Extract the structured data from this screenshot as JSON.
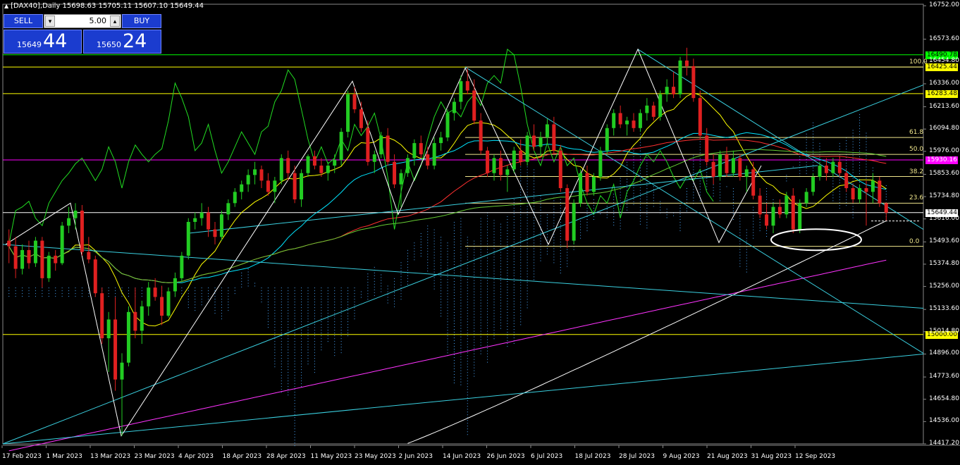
{
  "header": {
    "symbol_line": "[DAX40],Daily  15698.63 15705.11 15607.10 15649.44"
  },
  "trade_panel": {
    "sell_label": "SELL",
    "buy_label": "BUY",
    "lot": "5.00",
    "sell_price_small": "15649",
    "sell_price_big": "44",
    "buy_price_small": "15650",
    "buy_price_big": "24"
  },
  "chart_data": {
    "type": "candlestick",
    "symbol": "[DAX40]",
    "timeframe": "Daily",
    "ohlc_last": {
      "open": 15698.63,
      "high": 15705.11,
      "low": 15607.1,
      "close": 15649.44
    },
    "ylim": [
      14417.2,
      16760
    ],
    "y_ticks": [
      "16752.00",
      "16573.60",
      "16454.80",
      "16336.00",
      "16213.60",
      "16094.80",
      "15976.00",
      "15853.60",
      "15734.80",
      "15616.00",
      "15493.60",
      "15374.80",
      "15256.00",
      "15133.60",
      "15014.80",
      "14896.00",
      "14773.60",
      "14654.80",
      "14536.00",
      "14417.20"
    ],
    "x_ticks": [
      "17 Feb 2023",
      "1 Mar 2023",
      "13 Mar 2023",
      "23 Mar 2023",
      "4 Apr 2023",
      "18 Apr 2023",
      "28 Apr 2023",
      "11 May 2023",
      "23 May 2023",
      "2 Jun 2023",
      "14 Jun 2023",
      "26 Jun 2023",
      "6 Jul 2023",
      "18 Jul 2023",
      "28 Jul 2023",
      "9 Aug 2023",
      "21 Aug 2023",
      "31 Aug 2023",
      "12 Sep 2023"
    ],
    "horizontal_levels": [
      {
        "label": "16490.78",
        "value": 16490.78,
        "color": "#00ff00"
      },
      {
        "label": "16425.44",
        "value": 16425.44,
        "color": "#ffff00"
      },
      {
        "label": "16283.48",
        "value": 16283.48,
        "color": "#ffff00"
      },
      {
        "label": "15930.16",
        "value": 15930.16,
        "color": "#ff00ff"
      },
      {
        "label": "15649.44",
        "value": 15649.44,
        "color": "#ffffff"
      },
      {
        "label": "15000.00",
        "value": 15000.0,
        "color": "#ffff00"
      }
    ],
    "fibonacci": [
      {
        "label": "100.0",
        "value": 16425.44
      },
      {
        "label": "61.8",
        "value": 16050
      },
      {
        "label": "50.0",
        "value": 15960
      },
      {
        "label": "38.2",
        "value": 15842
      },
      {
        "label": "23.6",
        "value": 15700
      },
      {
        "label": "0.0",
        "value": 15470
      }
    ],
    "candles": [
      {
        "o": 15500,
        "h": 15560,
        "l": 15380,
        "c": 15470
      },
      {
        "o": 15470,
        "h": 15520,
        "l": 15300,
        "c": 15350
      },
      {
        "o": 15350,
        "h": 15480,
        "l": 15320,
        "c": 15450
      },
      {
        "o": 15450,
        "h": 15500,
        "l": 15350,
        "c": 15380
      },
      {
        "o": 15380,
        "h": 15520,
        "l": 15360,
        "c": 15500
      },
      {
        "o": 15500,
        "h": 15520,
        "l": 15250,
        "c": 15300
      },
      {
        "o": 15300,
        "h": 15440,
        "l": 15280,
        "c": 15420
      },
      {
        "o": 15420,
        "h": 15450,
        "l": 15340,
        "c": 15380
      },
      {
        "o": 15380,
        "h": 15600,
        "l": 15370,
        "c": 15580
      },
      {
        "o": 15580,
        "h": 15680,
        "l": 15540,
        "c": 15620
      },
      {
        "o": 15620,
        "h": 15700,
        "l": 15560,
        "c": 15660
      },
      {
        "o": 15660,
        "h": 15690,
        "l": 15420,
        "c": 15440
      },
      {
        "o": 15440,
        "h": 15520,
        "l": 15380,
        "c": 15400
      },
      {
        "o": 15400,
        "h": 15420,
        "l": 15200,
        "c": 15220
      },
      {
        "o": 15220,
        "h": 15250,
        "l": 14950,
        "c": 14980
      },
      {
        "o": 14980,
        "h": 15120,
        "l": 14800,
        "c": 15080
      },
      {
        "o": 15080,
        "h": 15200,
        "l": 14700,
        "c": 14760
      },
      {
        "o": 14760,
        "h": 14900,
        "l": 14460,
        "c": 14850
      },
      {
        "o": 14850,
        "h": 15150,
        "l": 14830,
        "c": 15120
      },
      {
        "o": 15120,
        "h": 15250,
        "l": 14980,
        "c": 15020
      },
      {
        "o": 15020,
        "h": 15180,
        "l": 14950,
        "c": 15150
      },
      {
        "o": 15150,
        "h": 15280,
        "l": 15100,
        "c": 15250
      },
      {
        "o": 15250,
        "h": 15300,
        "l": 15180,
        "c": 15200
      },
      {
        "o": 15200,
        "h": 15260,
        "l": 15050,
        "c": 15100
      },
      {
        "o": 15100,
        "h": 15250,
        "l": 15090,
        "c": 15230
      },
      {
        "o": 15230,
        "h": 15330,
        "l": 15200,
        "c": 15300
      },
      {
        "o": 15300,
        "h": 15440,
        "l": 15280,
        "c": 15420
      },
      {
        "o": 15420,
        "h": 15620,
        "l": 15400,
        "c": 15600
      },
      {
        "o": 15600,
        "h": 15650,
        "l": 15560,
        "c": 15620
      },
      {
        "o": 15620,
        "h": 15700,
        "l": 15580,
        "c": 15650
      },
      {
        "o": 15650,
        "h": 15680,
        "l": 15520,
        "c": 15560
      },
      {
        "o": 15560,
        "h": 15600,
        "l": 15480,
        "c": 15520
      },
      {
        "o": 15520,
        "h": 15660,
        "l": 15500,
        "c": 15640
      },
      {
        "o": 15640,
        "h": 15720,
        "l": 15610,
        "c": 15700
      },
      {
        "o": 15700,
        "h": 15780,
        "l": 15680,
        "c": 15760
      },
      {
        "o": 15760,
        "h": 15820,
        "l": 15720,
        "c": 15800
      },
      {
        "o": 15800,
        "h": 15880,
        "l": 15760,
        "c": 15850
      },
      {
        "o": 15850,
        "h": 15920,
        "l": 15800,
        "c": 15880
      },
      {
        "o": 15880,
        "h": 15900,
        "l": 15780,
        "c": 15820
      },
      {
        "o": 15820,
        "h": 15860,
        "l": 15740,
        "c": 15760
      },
      {
        "o": 15760,
        "h": 15840,
        "l": 15700,
        "c": 15820
      },
      {
        "o": 15820,
        "h": 15960,
        "l": 15800,
        "c": 15940
      },
      {
        "o": 15940,
        "h": 15980,
        "l": 15820,
        "c": 15860
      },
      {
        "o": 15860,
        "h": 15900,
        "l": 15700,
        "c": 15720
      },
      {
        "o": 15720,
        "h": 15880,
        "l": 15680,
        "c": 15860
      },
      {
        "o": 15860,
        "h": 15960,
        "l": 15840,
        "c": 15950
      },
      {
        "o": 15950,
        "h": 15980,
        "l": 15880,
        "c": 15900
      },
      {
        "o": 15900,
        "h": 15940,
        "l": 15840,
        "c": 15860
      },
      {
        "o": 15860,
        "h": 15920,
        "l": 15820,
        "c": 15900
      },
      {
        "o": 15900,
        "h": 15960,
        "l": 15860,
        "c": 15930
      },
      {
        "o": 15930,
        "h": 16100,
        "l": 15900,
        "c": 16080
      },
      {
        "o": 16080,
        "h": 16300,
        "l": 16050,
        "c": 16280
      },
      {
        "o": 16280,
        "h": 16320,
        "l": 16180,
        "c": 16200
      },
      {
        "o": 16200,
        "h": 16240,
        "l": 16080,
        "c": 16100
      },
      {
        "o": 16100,
        "h": 16140,
        "l": 15900,
        "c": 15920
      },
      {
        "o": 15920,
        "h": 15980,
        "l": 15860,
        "c": 15960
      },
      {
        "o": 15960,
        "h": 16080,
        "l": 15940,
        "c": 16060
      },
      {
        "o": 16060,
        "h": 16100,
        "l": 15900,
        "c": 15920
      },
      {
        "o": 15920,
        "h": 15960,
        "l": 15780,
        "c": 15800
      },
      {
        "o": 15800,
        "h": 15880,
        "l": 15680,
        "c": 15860
      },
      {
        "o": 15860,
        "h": 15960,
        "l": 15840,
        "c": 15940
      },
      {
        "o": 15940,
        "h": 16040,
        "l": 15900,
        "c": 16020
      },
      {
        "o": 16020,
        "h": 16060,
        "l": 15940,
        "c": 15960
      },
      {
        "o": 15960,
        "h": 16000,
        "l": 15880,
        "c": 15900
      },
      {
        "o": 15900,
        "h": 16050,
        "l": 15880,
        "c": 16020
      },
      {
        "o": 16020,
        "h": 16080,
        "l": 15980,
        "c": 16050
      },
      {
        "o": 16050,
        "h": 16200,
        "l": 16030,
        "c": 16180
      },
      {
        "o": 16180,
        "h": 16260,
        "l": 16140,
        "c": 16240
      },
      {
        "o": 16240,
        "h": 16380,
        "l": 16200,
        "c": 16350
      },
      {
        "o": 16350,
        "h": 16420,
        "l": 16280,
        "c": 16300
      },
      {
        "o": 16300,
        "h": 16360,
        "l": 16120,
        "c": 16140
      },
      {
        "o": 16140,
        "h": 16180,
        "l": 15960,
        "c": 15980
      },
      {
        "o": 15980,
        "h": 16000,
        "l": 15840,
        "c": 15860
      },
      {
        "o": 15860,
        "h": 15960,
        "l": 15820,
        "c": 15940
      },
      {
        "o": 15940,
        "h": 15980,
        "l": 15820,
        "c": 15850
      },
      {
        "o": 15850,
        "h": 15900,
        "l": 15760,
        "c": 15880
      },
      {
        "o": 15880,
        "h": 16000,
        "l": 15860,
        "c": 15980
      },
      {
        "o": 15980,
        "h": 16040,
        "l": 15900,
        "c": 15920
      },
      {
        "o": 15920,
        "h": 16080,
        "l": 15900,
        "c": 16060
      },
      {
        "o": 16060,
        "h": 16120,
        "l": 15980,
        "c": 16000
      },
      {
        "o": 16000,
        "h": 16080,
        "l": 15950,
        "c": 16050
      },
      {
        "o": 16050,
        "h": 16150,
        "l": 16020,
        "c": 16120
      },
      {
        "o": 16120,
        "h": 16160,
        "l": 15960,
        "c": 15980
      },
      {
        "o": 15980,
        "h": 16010,
        "l": 15760,
        "c": 15780
      },
      {
        "o": 15780,
        "h": 15800,
        "l": 15460,
        "c": 15500
      },
      {
        "o": 15500,
        "h": 15720,
        "l": 15480,
        "c": 15700
      },
      {
        "o": 15700,
        "h": 15880,
        "l": 15680,
        "c": 15860
      },
      {
        "o": 15860,
        "h": 15900,
        "l": 15740,
        "c": 15760
      },
      {
        "o": 15760,
        "h": 15860,
        "l": 15740,
        "c": 15840
      },
      {
        "o": 15840,
        "h": 16000,
        "l": 15820,
        "c": 15980
      },
      {
        "o": 15980,
        "h": 16120,
        "l": 15960,
        "c": 16100
      },
      {
        "o": 16100,
        "h": 16200,
        "l": 16060,
        "c": 16180
      },
      {
        "o": 16180,
        "h": 16220,
        "l": 16100,
        "c": 16120
      },
      {
        "o": 16120,
        "h": 16160,
        "l": 16060,
        "c": 16140
      },
      {
        "o": 16140,
        "h": 16180,
        "l": 16080,
        "c": 16100
      },
      {
        "o": 16100,
        "h": 16200,
        "l": 16080,
        "c": 16180
      },
      {
        "o": 16180,
        "h": 16260,
        "l": 16140,
        "c": 16220
      },
      {
        "o": 16220,
        "h": 16240,
        "l": 16140,
        "c": 16160
      },
      {
        "o": 16160,
        "h": 16300,
        "l": 16140,
        "c": 16280
      },
      {
        "o": 16280,
        "h": 16360,
        "l": 16240,
        "c": 16320
      },
      {
        "o": 16320,
        "h": 16400,
        "l": 16260,
        "c": 16280
      },
      {
        "o": 16280,
        "h": 16480,
        "l": 16260,
        "c": 16460
      },
      {
        "o": 16460,
        "h": 16528,
        "l": 16380,
        "c": 16430
      },
      {
        "o": 16430,
        "h": 16470,
        "l": 16240,
        "c": 16260
      },
      {
        "o": 16260,
        "h": 16300,
        "l": 16040,
        "c": 16060
      },
      {
        "o": 16060,
        "h": 16100,
        "l": 15900,
        "c": 15920
      },
      {
        "o": 15920,
        "h": 15960,
        "l": 15800,
        "c": 15840
      },
      {
        "o": 15840,
        "h": 15980,
        "l": 15820,
        "c": 15960
      },
      {
        "o": 15960,
        "h": 16000,
        "l": 15840,
        "c": 15860
      },
      {
        "o": 15860,
        "h": 15980,
        "l": 15840,
        "c": 15940
      },
      {
        "o": 15940,
        "h": 15960,
        "l": 15820,
        "c": 15840
      },
      {
        "o": 15840,
        "h": 15900,
        "l": 15760,
        "c": 15880
      },
      {
        "o": 15880,
        "h": 15920,
        "l": 15720,
        "c": 15740
      },
      {
        "o": 15740,
        "h": 15780,
        "l": 15620,
        "c": 15640
      },
      {
        "o": 15640,
        "h": 15700,
        "l": 15560,
        "c": 15580
      },
      {
        "o": 15580,
        "h": 15700,
        "l": 15540,
        "c": 15680
      },
      {
        "o": 15680,
        "h": 15720,
        "l": 15620,
        "c": 15640
      },
      {
        "o": 15640,
        "h": 15760,
        "l": 15620,
        "c": 15740
      },
      {
        "o": 15740,
        "h": 15780,
        "l": 15540,
        "c": 15560
      },
      {
        "o": 15560,
        "h": 15720,
        "l": 15540,
        "c": 15700
      },
      {
        "o": 15700,
        "h": 15780,
        "l": 15680,
        "c": 15760
      },
      {
        "o": 15760,
        "h": 15860,
        "l": 15740,
        "c": 15840
      },
      {
        "o": 15840,
        "h": 15920,
        "l": 15820,
        "c": 15900
      },
      {
        "o": 15900,
        "h": 15940,
        "l": 15820,
        "c": 15860
      },
      {
        "o": 15860,
        "h": 15940,
        "l": 15840,
        "c": 15920
      },
      {
        "o": 15920,
        "h": 15950,
        "l": 15840,
        "c": 15860
      },
      {
        "o": 15860,
        "h": 15880,
        "l": 15760,
        "c": 15780
      },
      {
        "o": 15780,
        "h": 15800,
        "l": 15700,
        "c": 15720
      },
      {
        "o": 15720,
        "h": 15800,
        "l": 15700,
        "c": 15780
      },
      {
        "o": 15780,
        "h": 15820,
        "l": 15580,
        "c": 15760
      },
      {
        "o": 15760,
        "h": 15860,
        "l": 15700,
        "c": 15820
      },
      {
        "o": 15820,
        "h": 15840,
        "l": 15680,
        "c": 15700
      },
      {
        "o": 15698.63,
        "h": 15705.11,
        "l": 15607.1,
        "c": 15649.44
      }
    ],
    "indicators": [
      "Ichimoku cloud",
      "Moving averages",
      "Trend lines",
      "Fibonacci retracement"
    ]
  }
}
